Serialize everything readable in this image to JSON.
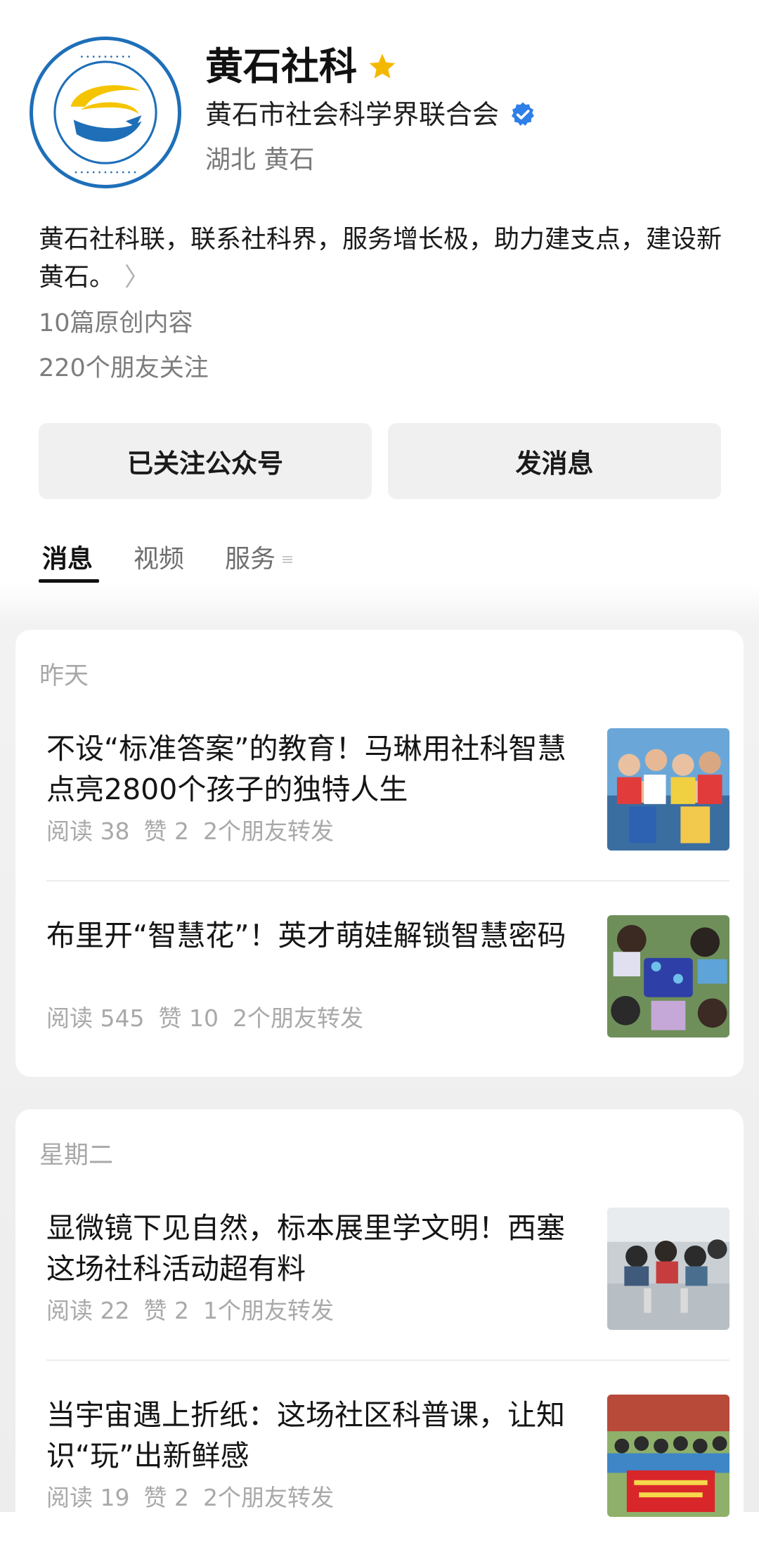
{
  "account": {
    "name": "黄石社科",
    "org": "黄石市社会科学界联合会",
    "location": "湖北 黄石",
    "bio": "黄石社科联，联系社科界，服务增长极，助力建支点，建设新黄石。",
    "original_count": "10篇原创内容",
    "friends_following": "220个朋友关注",
    "star_color": "#f5b800",
    "verified_color": "#2f7fe8"
  },
  "buttons": {
    "follow": "已关注公众号",
    "message": "发消息"
  },
  "tabs": [
    {
      "label": "消息",
      "active": true
    },
    {
      "label": "视频",
      "active": false
    },
    {
      "label": "服务",
      "active": false
    }
  ],
  "feed": [
    {
      "date": "昨天",
      "articles": [
        {
          "title": "不设“标准答案”的教育！马琳用社科智慧点亮2800个孩子的独特人生",
          "reads": "阅读 38",
          "likes": "赞 2",
          "shares": "2个朋友转发",
          "thumb_icon": "children-group-photo"
        },
        {
          "title": "布里开“智慧花”！英才萌娃解锁智慧密码",
          "reads": "阅读 545",
          "likes": "赞 10",
          "shares": "2个朋友转发",
          "thumb_icon": "kids-experiment-photo"
        }
      ]
    },
    {
      "date": "星期二",
      "articles": [
        {
          "title": "显微镜下见自然，标本展里学文明！西塞这场社科活动超有料",
          "reads": "阅读 22",
          "likes": "赞 2",
          "shares": "1个朋友转发",
          "thumb_icon": "microscope-activity-photo"
        },
        {
          "title": "当宇宙遇上折纸：这场社区科普课，让知识“玩”出新鲜感",
          "reads": "阅读 19",
          "likes": "赞 2",
          "shares": "2个朋友转发",
          "thumb_icon": "community-banner-photo"
        }
      ]
    }
  ]
}
